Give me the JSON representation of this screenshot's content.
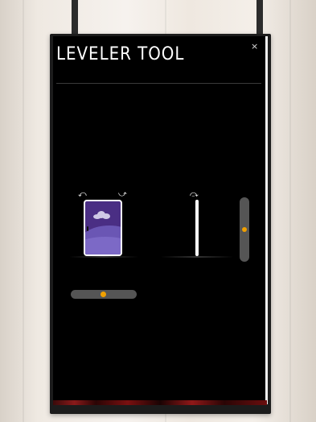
{
  "panel": {
    "title": "LEVELER TOOL",
    "close_glyph": "×"
  },
  "icons": {
    "rotate_left": "rotate-left-icon",
    "rotate_right": "rotate-right-icon",
    "arrow_glyph_left": "⤺",
    "arrow_glyph_right": "⤻",
    "arrow_glyph_top": "⤼"
  },
  "colors": {
    "accent_knob": "#f0a000",
    "screen_bg": "#000000",
    "phone_screen": "#4a2e84"
  },
  "sliders": {
    "vertical_level": 0.5,
    "horizontal_level": 0.5
  }
}
